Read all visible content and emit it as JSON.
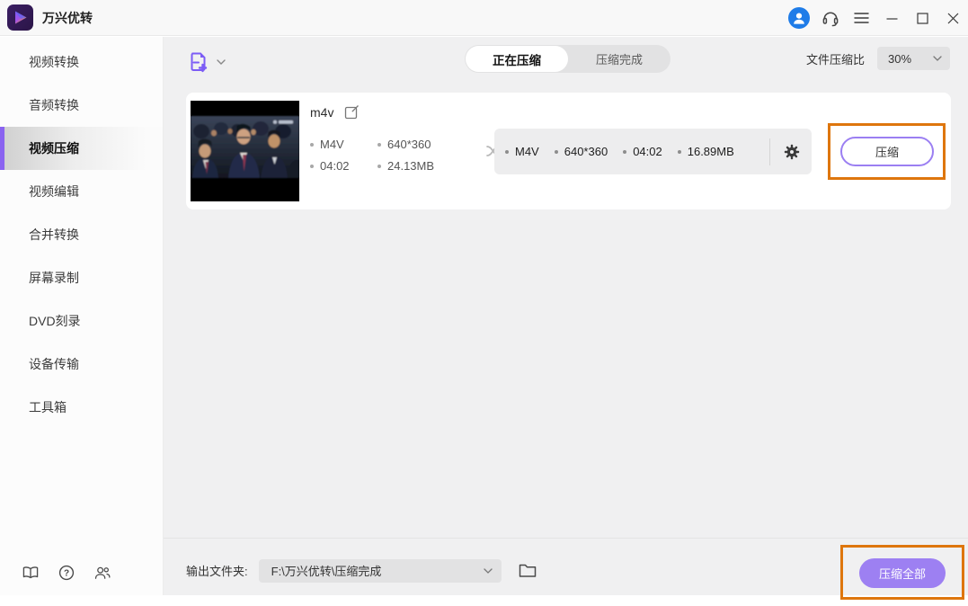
{
  "titlebar": {
    "app_name": "万兴优转"
  },
  "sidebar": {
    "active_index": 2,
    "items": [
      {
        "label": "视频转换"
      },
      {
        "label": "音频转换"
      },
      {
        "label": "视频压缩"
      },
      {
        "label": "视频编辑"
      },
      {
        "label": "合并转换"
      },
      {
        "label": "屏幕录制"
      },
      {
        "label": "DVD刻录"
      },
      {
        "label": "设备传输"
      },
      {
        "label": "工具箱"
      }
    ]
  },
  "toolbar": {
    "tabs": [
      {
        "label": "正在压缩"
      },
      {
        "label": "压缩完成"
      }
    ],
    "active_tab": "正在压缩",
    "ratio_label": "文件压缩比",
    "ratio_value": "30%"
  },
  "task": {
    "name": "m4v",
    "source": {
      "format": "M4V",
      "resolution": "640*360",
      "duration": "04:02",
      "size": "24.13MB"
    },
    "output": {
      "format": "M4V",
      "resolution": "640*360",
      "duration": "04:02",
      "size": "16.89MB"
    },
    "compress_label": "压缩"
  },
  "footer": {
    "folder_label": "输出文件夹:",
    "folder_path": "F:\\万兴优转\\压缩完成",
    "compress_all_label": "压缩全部"
  },
  "icons": {
    "logo": "play-triangle",
    "user": "user-avatar",
    "support": "headset",
    "menu": "hamburger-menu",
    "minimize": "minimize",
    "maximize": "maximize",
    "close": "close",
    "add_file": "document-plus",
    "chevron": "chevron-down",
    "edit": "edit-pencil",
    "shuffle": "shuffle-arrows",
    "settings": "gear",
    "guide": "open-book",
    "help": "question-circle",
    "community": "users",
    "folder": "folder"
  },
  "colors": {
    "accent_purple": "#8a63f0",
    "button_purple": "#9d80f2",
    "annotation_orange": "#de760d",
    "avatar_blue": "#1f7ce8"
  }
}
